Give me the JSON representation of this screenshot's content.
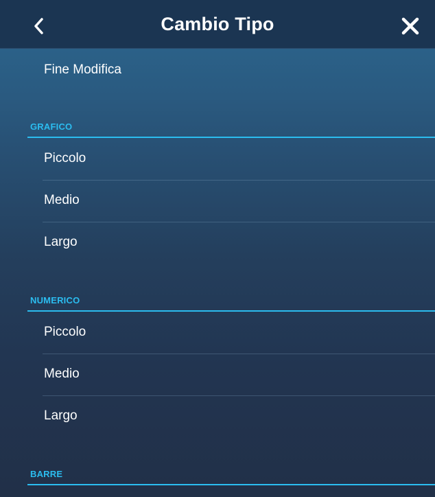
{
  "header": {
    "title": "Cambio Tipo",
    "back_icon": "chevron-left-icon",
    "close_icon": "close-icon"
  },
  "menu": {
    "finish_label": "Fine Modifica",
    "sections": [
      {
        "title": "GRAFICO",
        "items": [
          {
            "label": "Piccolo"
          },
          {
            "label": "Medio"
          },
          {
            "label": "Largo"
          }
        ]
      },
      {
        "title": "NUMERICO",
        "items": [
          {
            "label": "Piccolo"
          },
          {
            "label": "Medio"
          },
          {
            "label": "Largo"
          }
        ]
      },
      {
        "title": "BARRE",
        "items": []
      }
    ]
  },
  "colors": {
    "accent": "#2bbdf0",
    "header_bg": "#1b3552",
    "panel_top": "#2b6188",
    "panel_bottom": "#213048"
  }
}
